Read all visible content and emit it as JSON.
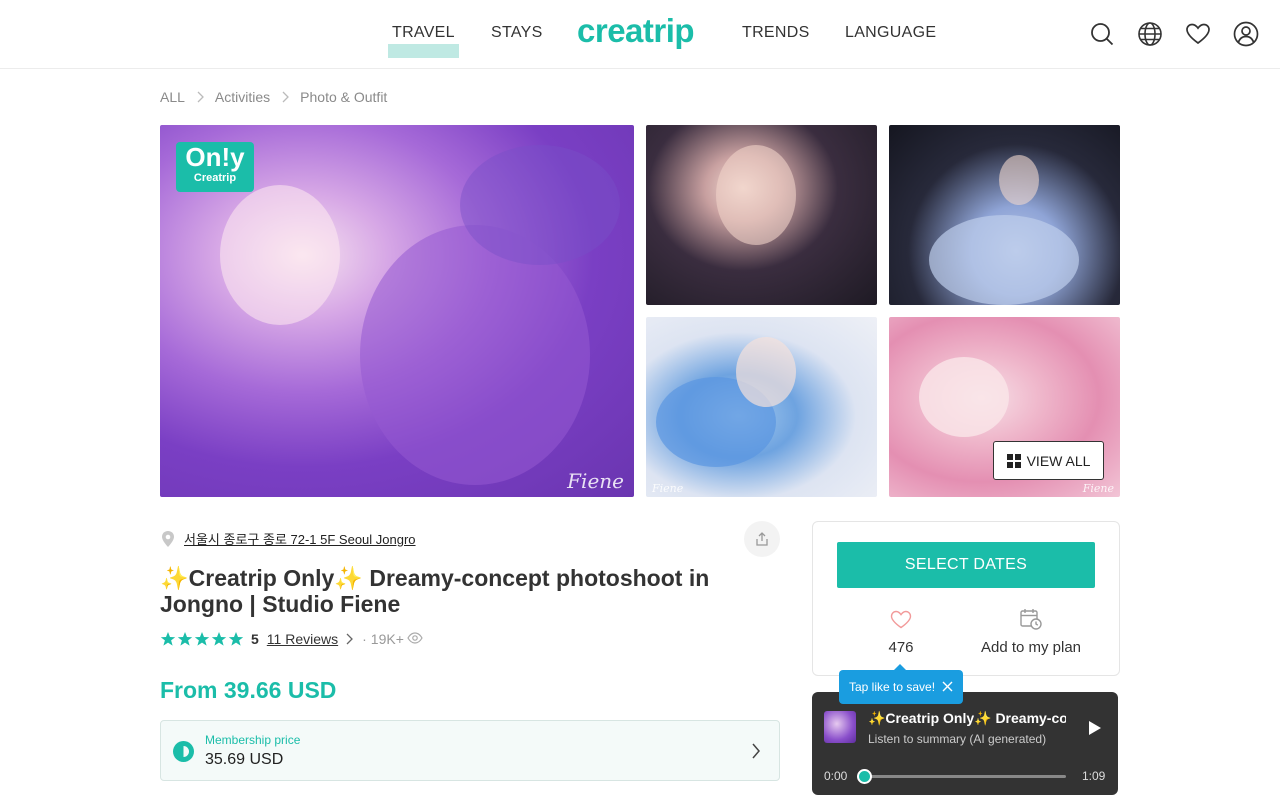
{
  "header": {
    "nav": [
      "TRAVEL",
      "STAYS",
      "TRENDS",
      "LANGUAGE"
    ],
    "logo": "creatrip",
    "icons": [
      "search-icon",
      "globe-icon",
      "heart-icon",
      "user-icon"
    ],
    "brand_color": "#1bbda9"
  },
  "breadcrumb": [
    "ALL",
    "Activities",
    "Photo & Outfit"
  ],
  "gallery": {
    "badge_top": "On!y",
    "badge_bottom": "Creatrip",
    "signature": "Fiene",
    "view_all": "VIEW ALL"
  },
  "product": {
    "address": "서울시 종로구 종로 72-1 5F Seoul Jongro",
    "title": "✨Creatrip Only✨ Dreamy-concept photoshoot in Jongno | Studio Fiene",
    "rating": "5",
    "reviews": "11 Reviews",
    "views": "19K+",
    "price": "From 39.66 USD",
    "membership_label": "Membership price",
    "membership_price": "35.69 USD"
  },
  "booking": {
    "select_dates": "SELECT DATES",
    "like_count": "476",
    "add_to_plan": "Add to my plan",
    "tooltip": "Tap like to save!"
  },
  "player": {
    "title": "✨Creatrip Only✨ Dreamy-concept photoshoot in Jongno | Studio Fiene",
    "subtitle": "Listen to summary (AI generated)",
    "current_time": "0:00",
    "total_time": "1:09",
    "progress": 0
  }
}
